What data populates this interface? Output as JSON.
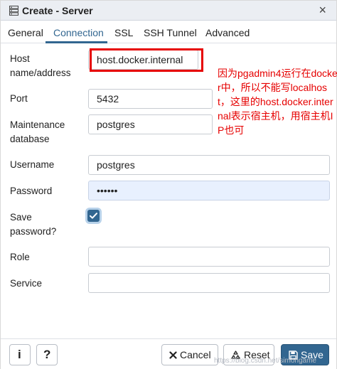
{
  "dialog": {
    "title": "Create - Server",
    "title_icon": "server-icon",
    "close_glyph": "×"
  },
  "tabs": [
    {
      "label": "General",
      "active": false
    },
    {
      "label": "Connection",
      "active": true
    },
    {
      "label": "SSL",
      "active": false
    },
    {
      "label": "SSH Tunnel",
      "active": false
    },
    {
      "label": "Advanced",
      "active": false
    }
  ],
  "form": {
    "host_label_1": "Host",
    "host_label_2": "name/address",
    "host_value": "host.docker.internal",
    "port_label": "Port",
    "port_value": "5432",
    "maint_label_1": "Maintenance",
    "maint_label_2": "database",
    "maint_value": "postgres",
    "username_label": "Username",
    "username_value": "postgres",
    "password_label": "Password",
    "password_value": "••••••",
    "save_pw_label_1": "Save",
    "save_pw_label_2": "password?",
    "save_pw_checked": true,
    "role_label": "Role",
    "role_value": "",
    "service_label": "Service",
    "service_value": ""
  },
  "annotation": {
    "text": "因为pgadmin4运行在docker中，所以不能写localhost，这里的host.docker.internal表示宿主机，用宿主机IP也可",
    "color": "#e60000"
  },
  "footer": {
    "info_glyph": "i",
    "help_glyph": "?",
    "cancel_label": "Cancel",
    "reset_label": "Reset",
    "save_label": "Save"
  },
  "watermark": "https://blog.csdn.net/simongame",
  "colors": {
    "accent": "#326690",
    "highlight": "#e60000",
    "password_bg": "#e8f0fe"
  }
}
